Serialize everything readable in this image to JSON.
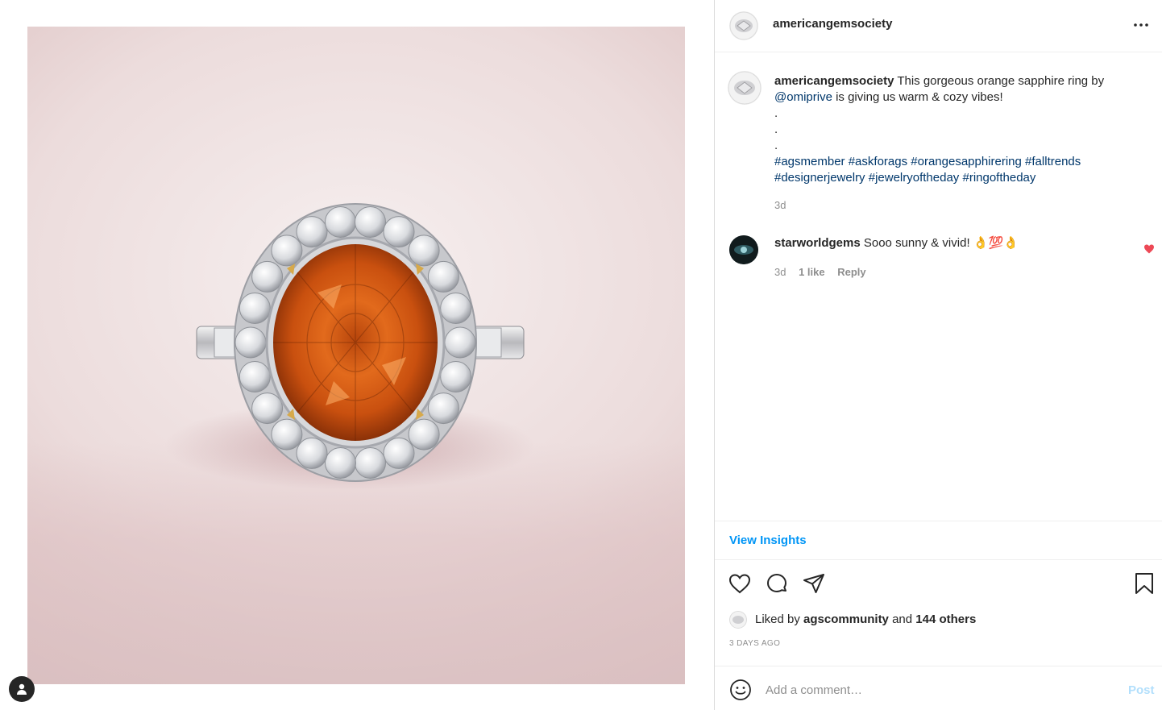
{
  "post": {
    "username": "americangemsociety",
    "image_alt": "",
    "caption": {
      "username": "americangemsociety",
      "text_before_mention": " This gorgeous orange sapphire ring by ",
      "mention": "@omiprive",
      "text_after_mention": " is giving us warm & cozy vibes!",
      "dots": [
        ".",
        ".",
        "."
      ],
      "hashtags_line1": [
        "#agsmember",
        "#askforags",
        "#orangesapphirering",
        "#falltrends"
      ],
      "hashtags_line2": [
        "#designerjewelry",
        "#jewelryoftheday",
        "#ringoftheday"
      ],
      "time": "3d"
    },
    "comments": [
      {
        "username": "starworldgems",
        "text": " Sooo sunny & vivid! 👌💯👌",
        "time": "3d",
        "likes": "1 like",
        "reply_label": "Reply",
        "liked": true
      }
    ],
    "view_insights_label": "View Insights",
    "liked_by": {
      "prefix": "Liked by ",
      "user": "agscommunity",
      "middle": " and ",
      "others": "144 others"
    },
    "timestamp": "3 DAYS AGO",
    "comment_placeholder": "Add a comment…",
    "post_label": "Post"
  },
  "colors": {
    "accent_blue": "#0095f6",
    "link_blue": "#00376b",
    "heart_red": "#ed4956",
    "muted": "#8e8e8e"
  },
  "icons": [
    "person-icon",
    "more-options-icon",
    "heart-icon",
    "comment-icon",
    "share-icon",
    "bookmark-icon",
    "emoji-icon"
  ]
}
